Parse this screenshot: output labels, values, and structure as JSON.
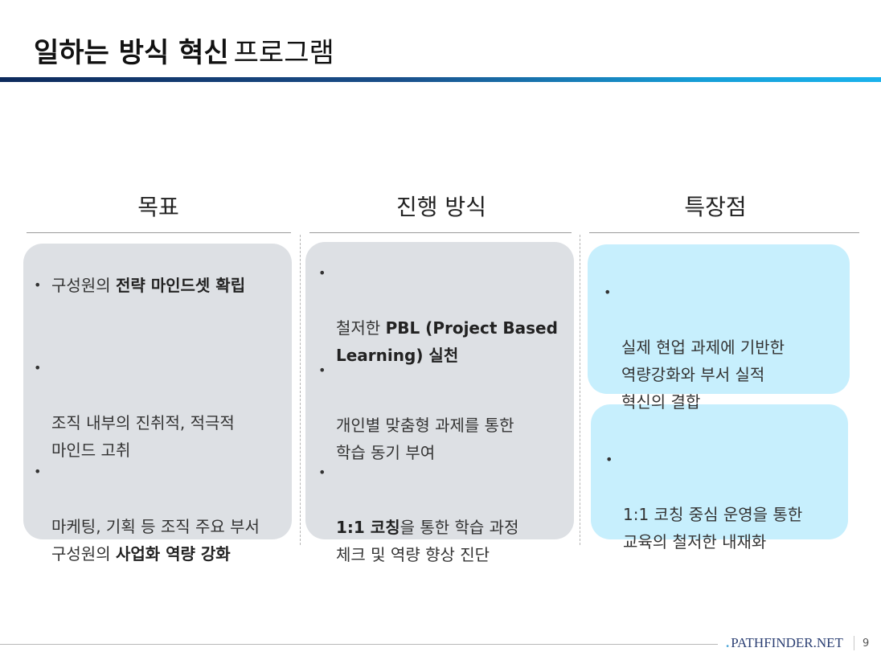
{
  "title": {
    "bold": "일하는 방식 혁신",
    "light": "프로그램"
  },
  "columns": [
    {
      "header": "목표",
      "bullets": [
        {
          "pre": "구성원의 ",
          "bold": "전략 마인드셋 확립",
          "post": ""
        },
        {
          "pre": "조직 내부의 진취적, 적극적\n마인드 고취",
          "bold": "",
          "post": ""
        },
        {
          "pre": "마케팅, 기획 등 조직 주요 부서\n구성원의 ",
          "bold": "사업화 역량 강화",
          "post": ""
        }
      ]
    },
    {
      "header": "진행 방식",
      "bullets": [
        {
          "pre": "철저한 ",
          "bold": "PBL (Project Based\nLearning) 실천",
          "post": ""
        },
        {
          "pre": "개인별 맞춤형 과제를 통한\n학습 동기 부여",
          "bold": "",
          "post": ""
        },
        {
          "pre": "",
          "bold": "1:1 코칭",
          "post": "을 통한 학습 과정\n체크 및 역량 향상 진단"
        }
      ]
    },
    {
      "header": "특장점",
      "bullets": [
        {
          "pre": "실제 현업 과제에 기반한\n역량강화와 부서 실적\n혁신의 결합",
          "bold": "",
          "post": ""
        },
        {
          "pre": "1:1 코칭 중심 운영을 통한\n교육의 철저한 내재화",
          "bold": "",
          "post": ""
        }
      ]
    }
  ],
  "footer": {
    "brand": "PATHFINDER.NET",
    "page": "9"
  },
  "colors": {
    "accent_dark": "#0d2a5c",
    "accent_light": "#1ab2ec",
    "panel_gray": "#dde0e4",
    "panel_blue": "#c7effd"
  }
}
